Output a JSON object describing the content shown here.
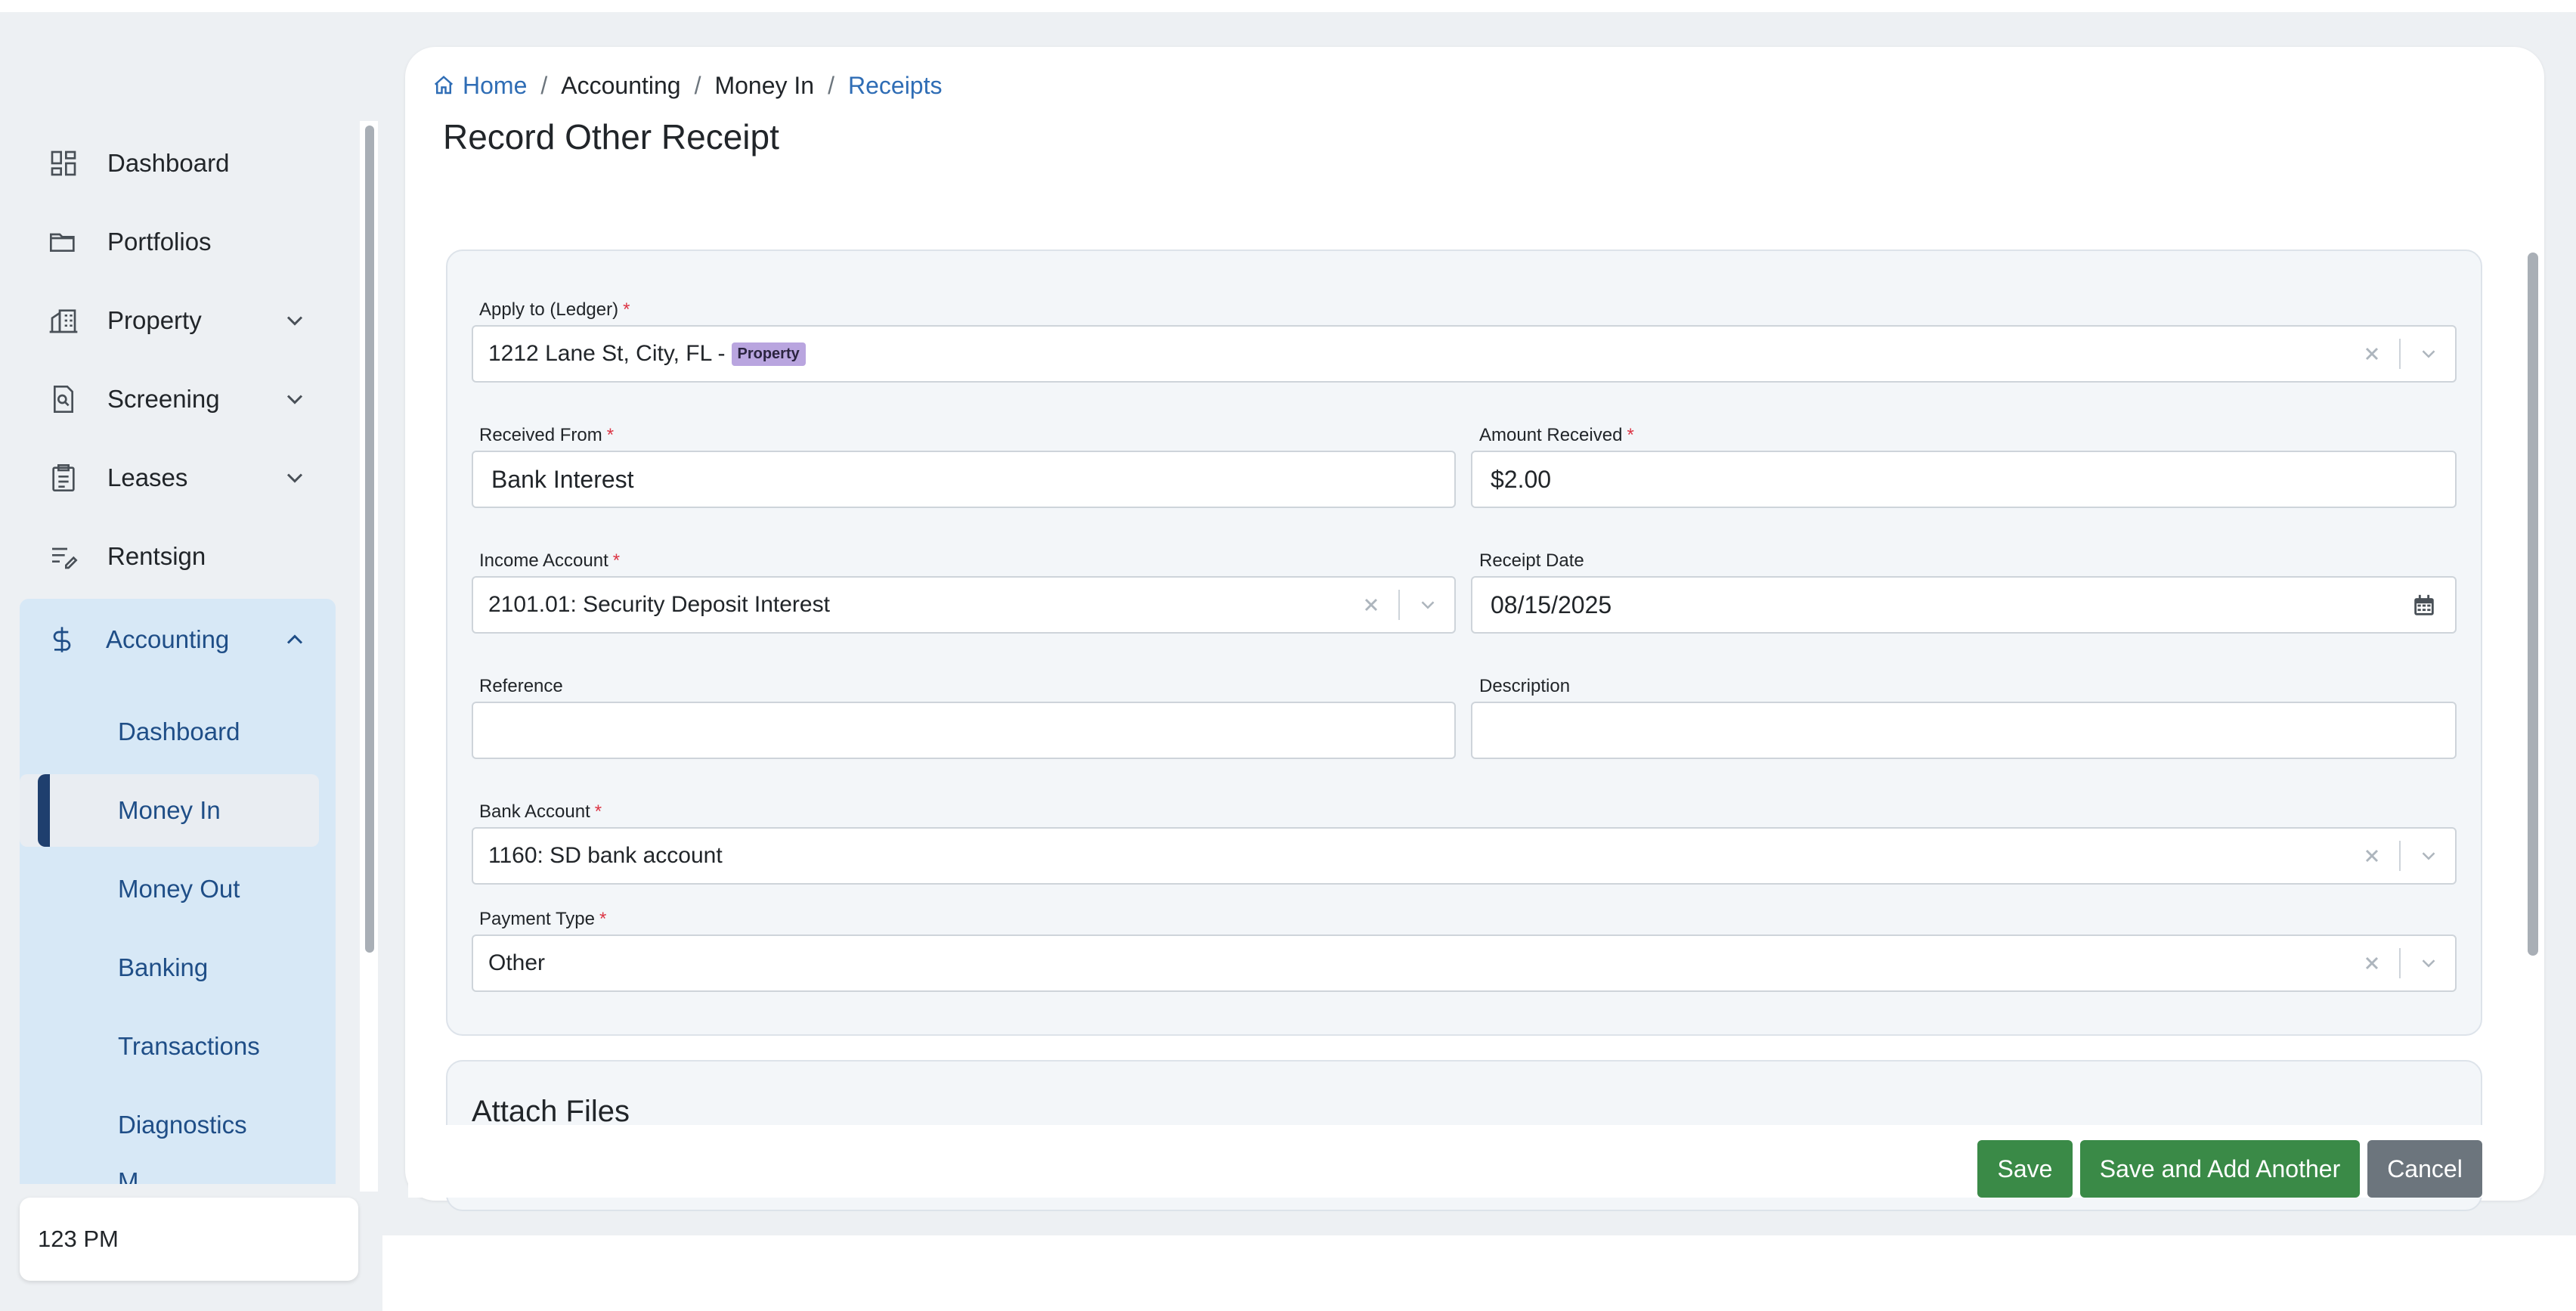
{
  "sidebar": {
    "items": [
      {
        "label": "Dashboard",
        "icon": "dashboard-icon"
      },
      {
        "label": "Portfolios",
        "icon": "folder-icon"
      },
      {
        "label": "Property",
        "icon": "building-icon"
      },
      {
        "label": "Screening",
        "icon": "screening-icon"
      },
      {
        "label": "Leases",
        "icon": "clipboard-icon"
      },
      {
        "label": "Rentsign",
        "icon": "sign-icon"
      }
    ],
    "accounting": {
      "label": "Accounting",
      "icon": "dollar-icon",
      "sub_items": [
        {
          "label": "Dashboard"
        },
        {
          "label": "Money In",
          "active": true
        },
        {
          "label": "Money Out"
        },
        {
          "label": "Banking"
        },
        {
          "label": "Transactions"
        },
        {
          "label": "Diagnostics"
        },
        {
          "label": "M..."
        }
      ]
    },
    "time_card": "123 PM"
  },
  "breadcrumb": {
    "home": "Home",
    "accounting": "Accounting",
    "money_in": "Money In",
    "receipts": "Receipts",
    "separator": "/"
  },
  "page_title": "Record Other Receipt",
  "form": {
    "apply_to": {
      "label": "Apply to (Ledger)",
      "value": "1212 Lane St, City, FL -",
      "badge": "Property",
      "required": "*"
    },
    "received_from": {
      "label": "Received From",
      "value": "Bank Interest",
      "required": "*"
    },
    "amount_received": {
      "label": "Amount Received",
      "value": "$2.00",
      "required": "*"
    },
    "income_account": {
      "label": "Income Account",
      "value": "2101.01: Security Deposit Interest",
      "required": "*"
    },
    "receipt_date": {
      "label": "Receipt Date",
      "value": "08/15/2025"
    },
    "reference": {
      "label": "Reference",
      "value": ""
    },
    "description": {
      "label": "Description",
      "value": ""
    },
    "bank_account": {
      "label": "Bank Account",
      "value": "1160: SD bank account",
      "required": "*"
    },
    "payment_type": {
      "label": "Payment Type",
      "value": "Other",
      "required": "*"
    }
  },
  "attach_files": {
    "title": "Attach Files"
  },
  "buttons": {
    "save": "Save",
    "save_add": "Save and Add Another",
    "cancel": "Cancel"
  },
  "colors": {
    "accent": "#1f4e87",
    "link": "#2f6db5",
    "save_green": "#3a8a47",
    "cancel_gray": "#6c757d",
    "sidebar_active_bg": "#d7e8f6",
    "badge": "#b9a5df",
    "required": "#dc3545"
  }
}
